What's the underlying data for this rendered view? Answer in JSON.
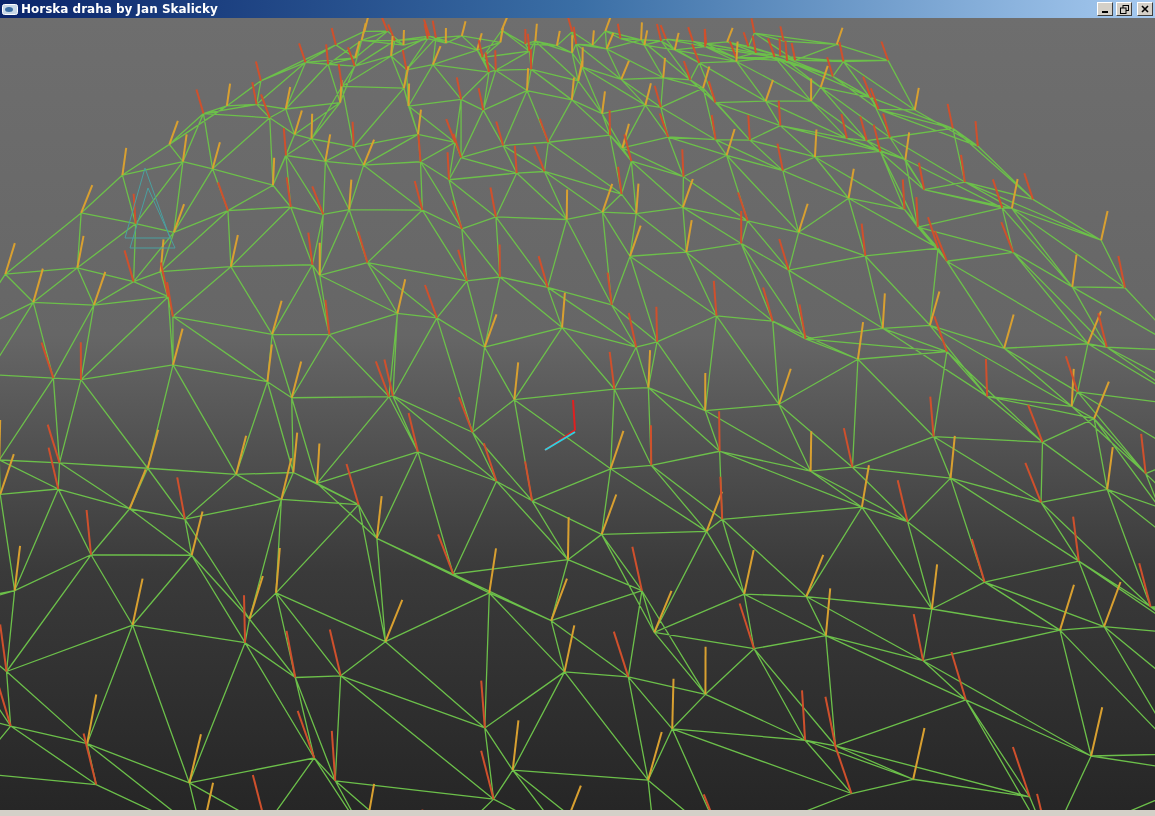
{
  "window": {
    "title": "Horska draha by Jan Skalicky"
  }
}
